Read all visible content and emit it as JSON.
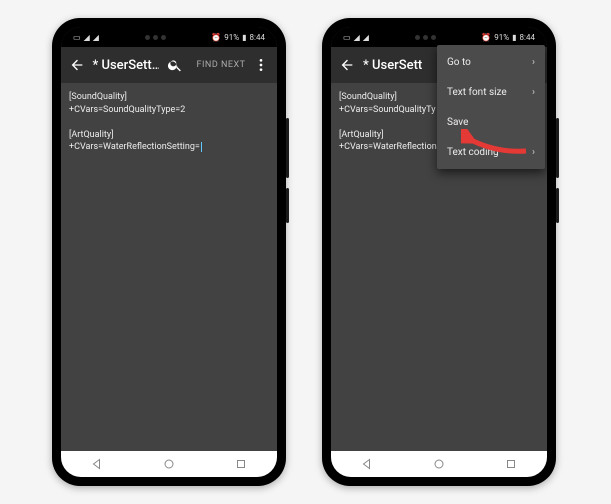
{
  "status": {
    "battery": "91%",
    "time": "8:44"
  },
  "appbar": {
    "title": "* UserSett…",
    "title_clipped": "* UserSett",
    "find_next": "FIND NEXT"
  },
  "editor": {
    "left": "[SoundQuality]\n+CVars=SoundQualityType=2\n\n[ArtQuality]\n+CVars=WaterReflectionSetting=",
    "right": "[SoundQuality]\n+CVars=SoundQualityTy\n\n[ArtQuality]\n+CVars=WaterReflection"
  },
  "menu": {
    "items": [
      {
        "label": "Go to",
        "submenu": true
      },
      {
        "label": "Text font size",
        "submenu": true
      },
      {
        "label": "Save",
        "submenu": false,
        "highlight": true
      },
      {
        "label": "Text coding",
        "submenu": true
      }
    ]
  },
  "icons": {
    "back": "back-arrow",
    "search": "search",
    "overflow": "more-vert",
    "nav_back": "triangle-left",
    "nav_home": "circle",
    "nav_recent": "square",
    "chevron": "›"
  },
  "colors": {
    "editor_bg": "#424242",
    "appbar_bg": "#2e2e2e",
    "menu_bg": "#4b4b4b",
    "arrow": "#e53935"
  }
}
